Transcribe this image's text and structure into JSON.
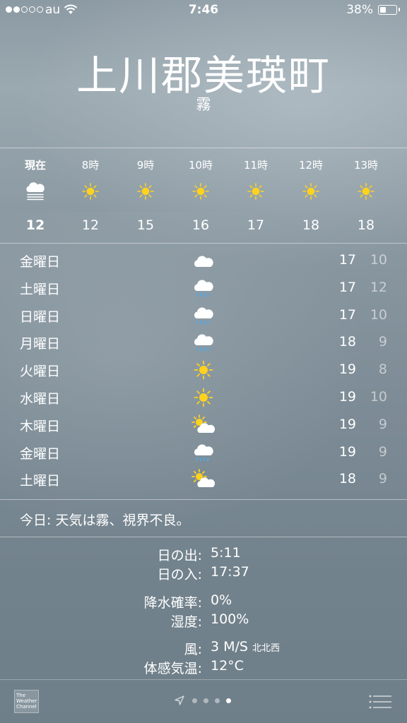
{
  "status_bar": {
    "carrier": "au",
    "time": "7:46",
    "battery_percent": "38%",
    "battery_level": 0.38,
    "signal_dots_filled": 2,
    "signal_dots_total": 5
  },
  "location": {
    "city": "上川郡美瑛町",
    "condition": "霧"
  },
  "hourly": [
    {
      "label": "現在",
      "icon": "fog-icon",
      "temp": "12"
    },
    {
      "label": "8時",
      "icon": "sun-icon",
      "temp": "12"
    },
    {
      "label": "9時",
      "icon": "sun-icon",
      "temp": "15"
    },
    {
      "label": "10時",
      "icon": "sun-icon",
      "temp": "16"
    },
    {
      "label": "11時",
      "icon": "sun-icon",
      "temp": "17"
    },
    {
      "label": "12時",
      "icon": "sun-icon",
      "temp": "18"
    },
    {
      "label": "13時",
      "icon": "sun-icon",
      "temp": "18"
    }
  ],
  "daily": [
    {
      "day": "金曜日",
      "icon": "cloud-icon",
      "high": "17",
      "low": "10"
    },
    {
      "day": "土曜日",
      "icon": "rain-icon",
      "high": "17",
      "low": "12"
    },
    {
      "day": "日曜日",
      "icon": "rain-icon",
      "high": "17",
      "low": "10"
    },
    {
      "day": "月曜日",
      "icon": "rain-icon",
      "high": "18",
      "low": "9"
    },
    {
      "day": "火曜日",
      "icon": "sun-icon",
      "high": "19",
      "low": "8"
    },
    {
      "day": "水曜日",
      "icon": "sun-icon",
      "high": "19",
      "low": "10"
    },
    {
      "day": "木曜日",
      "icon": "partly-cloudy-icon",
      "high": "19",
      "low": "9"
    },
    {
      "day": "金曜日",
      "icon": "rain-icon",
      "high": "19",
      "low": "9"
    },
    {
      "day": "土曜日",
      "icon": "partly-cloudy-icon",
      "high": "18",
      "low": "9"
    }
  ],
  "summary": "今日: 天気は霧、視界不良。",
  "details": {
    "sunrise": {
      "label": "日の出:",
      "value": "5:11"
    },
    "sunset": {
      "label": "日の入:",
      "value": "17:37"
    },
    "precip": {
      "label": "降水確率:",
      "value": "0%"
    },
    "humidity": {
      "label": "湿度:",
      "value": "100%"
    },
    "wind": {
      "label": "風:",
      "value": "3 M/S",
      "direction": "北北西"
    },
    "feels_like": {
      "label": "体感気温:",
      "value": "12°C"
    }
  },
  "bottom_bar": {
    "logo_text": "The Weather Channel",
    "page_count": 4,
    "active_page": 4
  },
  "colors": {
    "sun": "#ffd21e",
    "rain": "#4fa8e6",
    "text": "#ffffff"
  }
}
